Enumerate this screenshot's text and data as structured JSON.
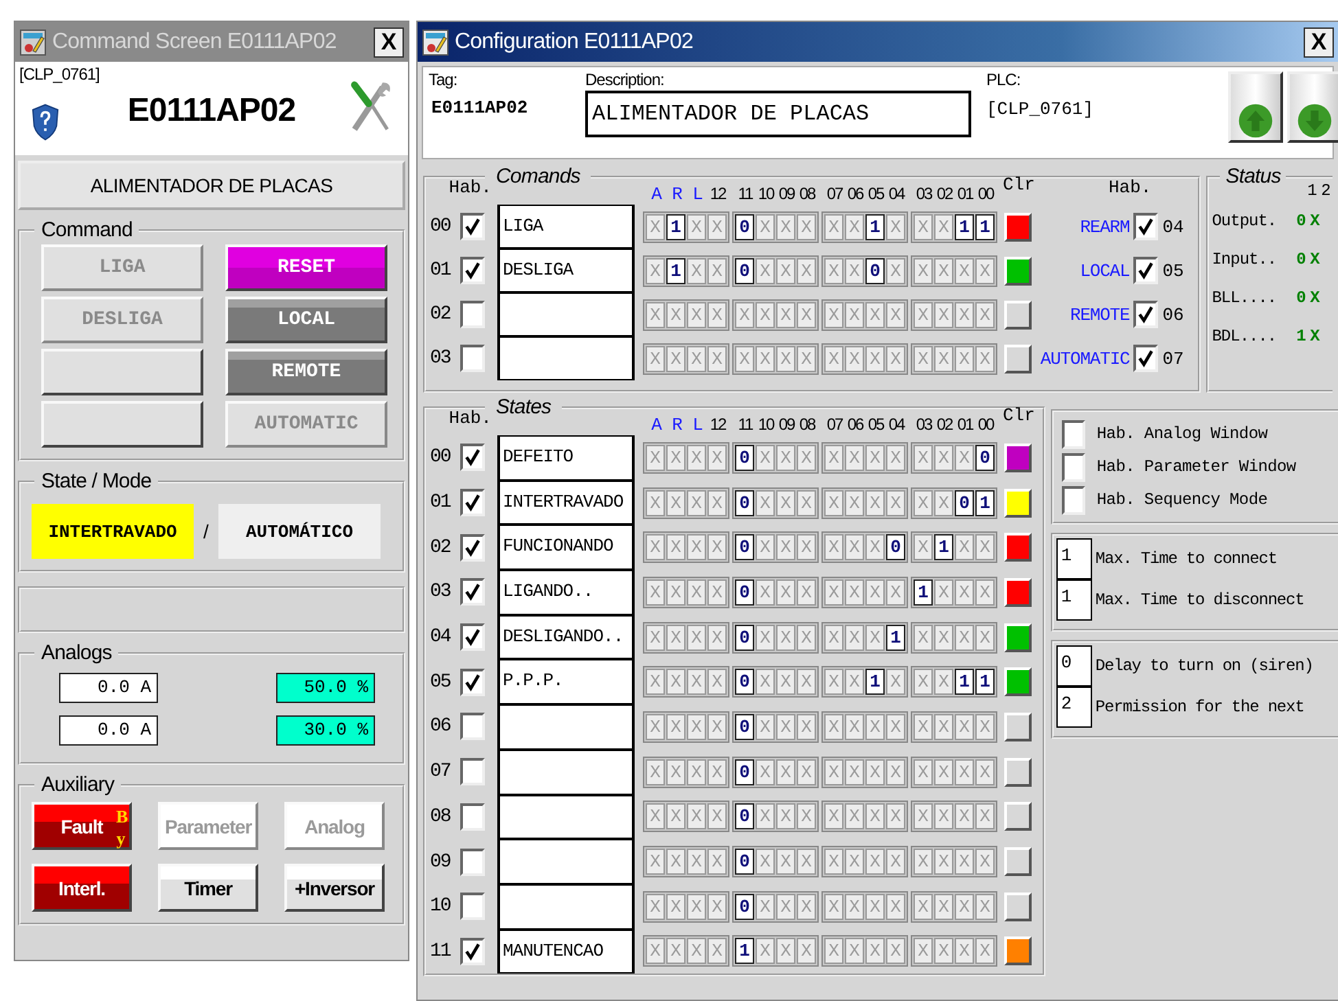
{
  "command_window": {
    "title": "Command Screen E0111AP02",
    "close": "X",
    "plc": "[CLP_0761]",
    "tag": "E0111AP02",
    "description": "ALIMENTADOR DE PLACAS",
    "command": {
      "title": "Command",
      "buttons": [
        {
          "label": "LIGA",
          "kind": "gray",
          "disabled": true
        },
        {
          "label": "RESET",
          "kind": "magenta",
          "disabled": false
        },
        {
          "label": "DESLIGA",
          "kind": "gray",
          "disabled": true
        },
        {
          "label": "LOCAL",
          "kind": "dark",
          "disabled": false
        },
        {
          "kind": "gray",
          "disabled": false
        },
        {
          "label": "REMOTE",
          "kind": "dark",
          "disabled": false
        },
        {
          "kind": "gray",
          "disabled": false
        },
        {
          "label": "AUTOMATIC",
          "kind": "gray",
          "disabled": true
        }
      ]
    },
    "state_mode": {
      "title": "State / Mode",
      "state": {
        "text": "INTERTRAVADO",
        "color": "#ffff00"
      },
      "separator": "/",
      "mode": {
        "text": "AUTOMÁTICO",
        "color": "#efefef"
      }
    },
    "analogs": {
      "title": "Analogs",
      "values": [
        {
          "text": "0.0 A",
          "color": "#ffffff"
        },
        {
          "text": "50.0 %",
          "color": "#00ffcc"
        },
        {
          "text": "0.0 A",
          "color": "#ffffff"
        },
        {
          "text": "30.0 %",
          "color": "#00ffcc"
        }
      ]
    },
    "auxiliary": {
      "title": "Auxiliary",
      "buttons": [
        {
          "label": "Fault",
          "kind": "red",
          "disabled": false,
          "badge": "By"
        },
        {
          "label": "Parameter",
          "kind": "white",
          "disabled": true
        },
        {
          "label": "Analog",
          "kind": "white",
          "disabled": true
        },
        {
          "label": "Interl.",
          "kind": "red",
          "disabled": false
        },
        {
          "label": "Timer",
          "kind": "white",
          "disabled": false
        },
        {
          "label": "+Inversor",
          "kind": "white",
          "disabled": false
        }
      ]
    }
  },
  "config_window": {
    "title": "Configuration E0111AP02",
    "close": "X",
    "tag_label": "Tag:",
    "tag": "E0111AP02",
    "description_label": "Description:",
    "description": "ALIMENTADOR DE PLACAS",
    "plc_label": "PLC:",
    "plc": "[CLP_0761]",
    "comands": {
      "title": "Comands",
      "hab": "Hab.",
      "clr": "Clr",
      "bit_headers": [
        {
          "text": "A",
          "kind": "flag"
        },
        {
          "text": "R",
          "kind": "flag"
        },
        {
          "text": "L",
          "kind": "flag"
        },
        {
          "text": "12",
          "kind": "bit"
        },
        {
          "text": "11",
          "kind": "bit"
        },
        {
          "text": "10",
          "kind": "bit"
        },
        {
          "text": "09",
          "kind": "bit"
        },
        {
          "text": "08",
          "kind": "bit"
        },
        {
          "text": "07",
          "kind": "bit"
        },
        {
          "text": "06",
          "kind": "bit"
        },
        {
          "text": "05",
          "kind": "bit"
        },
        {
          "text": "04",
          "kind": "bit"
        },
        {
          "text": "03",
          "kind": "bit"
        },
        {
          "text": "02",
          "kind": "bit"
        },
        {
          "text": "01",
          "kind": "bit"
        },
        {
          "text": "00",
          "kind": "bit"
        }
      ],
      "rows": [
        {
          "index": "00",
          "checked": true,
          "name": "LIGA",
          "bits": [
            "X",
            "1",
            "X",
            "X",
            "0",
            "X",
            "X",
            "X",
            "X",
            "X",
            "1",
            "X",
            "X",
            "X",
            "1",
            "1"
          ],
          "color": "#ff0000"
        },
        {
          "index": "01",
          "checked": true,
          "name": "DESLIGA",
          "bits": [
            "X",
            "1",
            "X",
            "X",
            "0",
            "X",
            "X",
            "X",
            "X",
            "X",
            "0",
            "X",
            "X",
            "X",
            "X",
            "X"
          ],
          "color": "#00c000"
        },
        {
          "index": "02",
          "checked": false,
          "bits": [
            "X",
            "X",
            "X",
            "X",
            "X",
            "X",
            "X",
            "X",
            "X",
            "X",
            "X",
            "X",
            "X",
            "X",
            "X",
            "X"
          ],
          "color": "#d8d8d8"
        },
        {
          "index": "03",
          "checked": false,
          "bits": [
            "X",
            "X",
            "X",
            "X",
            "X",
            "X",
            "X",
            "X",
            "X",
            "X",
            "X",
            "X",
            "X",
            "X",
            "X",
            "X"
          ],
          "color": "#d8d8d8"
        }
      ],
      "hab_right": "Hab.",
      "modes": [
        {
          "label": "REARM",
          "checked": true,
          "index": "04"
        },
        {
          "label": "LOCAL",
          "checked": true,
          "index": "05"
        },
        {
          "label": "REMOTE",
          "checked": true,
          "index": "06"
        },
        {
          "label": "AUTOMATIC",
          "checked": true,
          "index": "07"
        }
      ]
    },
    "status": {
      "title": "Status",
      "columns": [
        "1",
        "2"
      ],
      "rows": [
        {
          "label": "Output.",
          "values": [
            "0",
            "X"
          ]
        },
        {
          "label": "Input..",
          "values": [
            "0",
            "X"
          ]
        },
        {
          "label": "BLL....",
          "values": [
            "0",
            "X"
          ]
        },
        {
          "label": "BDL....",
          "values": [
            "1",
            "X"
          ]
        }
      ]
    },
    "states": {
      "title": "States",
      "hab": "Hab.",
      "clr": "Clr",
      "bit_headers": [
        {
          "text": "A",
          "kind": "flag"
        },
        {
          "text": "R",
          "kind": "flag"
        },
        {
          "text": "L",
          "kind": "flag"
        },
        {
          "text": "12",
          "kind": "bit"
        },
        {
          "text": "11",
          "kind": "bit"
        },
        {
          "text": "10",
          "kind": "bit"
        },
        {
          "text": "09",
          "kind": "bit"
        },
        {
          "text": "08",
          "kind": "bit"
        },
        {
          "text": "07",
          "kind": "bit"
        },
        {
          "text": "06",
          "kind": "bit"
        },
        {
          "text": "05",
          "kind": "bit"
        },
        {
          "text": "04",
          "kind": "bit"
        },
        {
          "text": "03",
          "kind": "bit"
        },
        {
          "text": "02",
          "kind": "bit"
        },
        {
          "text": "01",
          "kind": "bit"
        },
        {
          "text": "00",
          "kind": "bit"
        }
      ],
      "rows": [
        {
          "index": "00",
          "checked": true,
          "name": "DEFEITO",
          "bits": [
            "X",
            "X",
            "X",
            "X",
            "0",
            "X",
            "X",
            "X",
            "X",
            "X",
            "X",
            "X",
            "X",
            "X",
            "X",
            "0"
          ],
          "color": "#c000c0"
        },
        {
          "index": "01",
          "checked": true,
          "name": "INTERTRAVADO",
          "bits": [
            "X",
            "X",
            "X",
            "X",
            "0",
            "X",
            "X",
            "X",
            "X",
            "X",
            "X",
            "X",
            "X",
            "X",
            "0",
            "1"
          ],
          "color": "#ffff00"
        },
        {
          "index": "02",
          "checked": true,
          "name": "FUNCIONANDO",
          "bits": [
            "X",
            "X",
            "X",
            "X",
            "0",
            "X",
            "X",
            "X",
            "X",
            "X",
            "X",
            "0",
            "X",
            "1",
            "X",
            "X"
          ],
          "color": "#ff0000"
        },
        {
          "index": "03",
          "checked": true,
          "name": "LIGANDO..",
          "bits": [
            "X",
            "X",
            "X",
            "X",
            "0",
            "X",
            "X",
            "X",
            "X",
            "X",
            "X",
            "X",
            "1",
            "X",
            "X",
            "X"
          ],
          "color": "#ff0000"
        },
        {
          "index": "04",
          "checked": true,
          "name": "DESLIGANDO..",
          "bits": [
            "X",
            "X",
            "X",
            "X",
            "0",
            "X",
            "X",
            "X",
            "X",
            "X",
            "X",
            "1",
            "X",
            "X",
            "X",
            "X"
          ],
          "color": "#00c000"
        },
        {
          "index": "05",
          "checked": true,
          "name": "P.P.P.",
          "bits": [
            "X",
            "X",
            "X",
            "X",
            "0",
            "X",
            "X",
            "X",
            "X",
            "X",
            "1",
            "X",
            "X",
            "X",
            "1",
            "1"
          ],
          "color": "#00c000"
        },
        {
          "index": "06",
          "checked": false,
          "bits": [
            "X",
            "X",
            "X",
            "X",
            "0",
            "X",
            "X",
            "X",
            "X",
            "X",
            "X",
            "X",
            "X",
            "X",
            "X",
            "X"
          ],
          "color": "#d8d8d8"
        },
        {
          "index": "07",
          "checked": false,
          "bits": [
            "X",
            "X",
            "X",
            "X",
            "0",
            "X",
            "X",
            "X",
            "X",
            "X",
            "X",
            "X",
            "X",
            "X",
            "X",
            "X"
          ],
          "color": "#d8d8d8"
        },
        {
          "index": "08",
          "checked": false,
          "bits": [
            "X",
            "X",
            "X",
            "X",
            "0",
            "X",
            "X",
            "X",
            "X",
            "X",
            "X",
            "X",
            "X",
            "X",
            "X",
            "X"
          ],
          "color": "#d8d8d8"
        },
        {
          "index": "09",
          "checked": false,
          "bits": [
            "X",
            "X",
            "X",
            "X",
            "0",
            "X",
            "X",
            "X",
            "X",
            "X",
            "X",
            "X",
            "X",
            "X",
            "X",
            "X"
          ],
          "color": "#d8d8d8"
        },
        {
          "index": "10",
          "checked": false,
          "bits": [
            "X",
            "X",
            "X",
            "X",
            "0",
            "X",
            "X",
            "X",
            "X",
            "X",
            "X",
            "X",
            "X",
            "X",
            "X",
            "X"
          ],
          "color": "#d8d8d8"
        },
        {
          "index": "11",
          "checked": true,
          "name": "MANUTENCAO",
          "bits": [
            "X",
            "X",
            "X",
            "X",
            "1",
            "X",
            "X",
            "X",
            "X",
            "X",
            "X",
            "X",
            "X",
            "X",
            "X",
            "X"
          ],
          "color": "#ff8000"
        }
      ]
    },
    "options": [
      {
        "label": "Hab. Analog Window",
        "checked": false
      },
      {
        "label": "Hab. Parameter Window",
        "checked": false
      },
      {
        "label": "Hab. Sequency Mode",
        "checked": false
      }
    ],
    "times": [
      {
        "value": "1",
        "label": "Max. Time to connect"
      },
      {
        "value": "1",
        "label": "Max. Time to disconnect"
      }
    ],
    "delays": [
      {
        "value": "0",
        "label": "Delay to turn on (siren)"
      },
      {
        "value": "2",
        "label": "Permission for the next"
      }
    ]
  }
}
